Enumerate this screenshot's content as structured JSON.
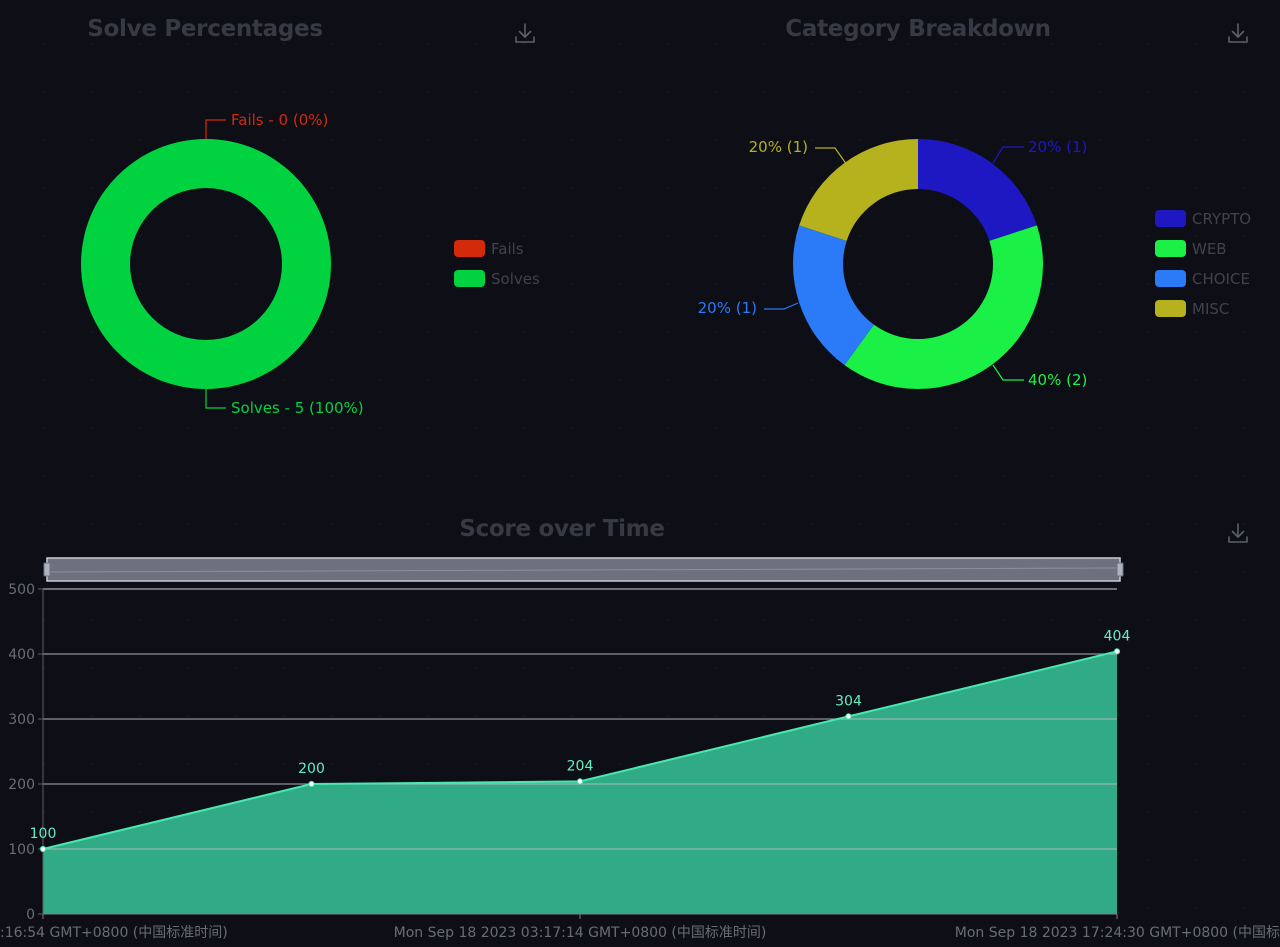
{
  "titles": {
    "solve": "Solve Percentages",
    "category": "Category Breakdown",
    "score": "Score over Time"
  },
  "icons": {
    "download": "download-icon"
  },
  "colors": {
    "background": "#0e0e17",
    "fails": "#d22a0a",
    "solves": "#00d240",
    "crypto": "#1e18c3",
    "web": "#1af045",
    "choice": "#2b7af7",
    "misc": "#b5b21d",
    "area_fill": "#31ab86",
    "area_line": "#49e8ad",
    "data_label": "#61f0c0",
    "axis_text": "#686c77",
    "legend_text": "#40434c",
    "title_text": "#373a44"
  },
  "chart_data": [
    {
      "type": "pie",
      "id": "solve",
      "title": "Solve Percentages",
      "slices": [
        {
          "name": "Fails",
          "value": 0,
          "label": "Fails - 0 (0%)",
          "color": "#d22a0a"
        },
        {
          "name": "Solves",
          "value": 5,
          "label": "Solves - 5 (100%)",
          "color": "#00d240"
        }
      ],
      "legend": [
        "Fails",
        "Solves"
      ],
      "legend_position": "right"
    },
    {
      "type": "pie",
      "id": "category",
      "title": "Category Breakdown",
      "slices": [
        {
          "name": "CRYPTO",
          "value": 1,
          "label": "20% (1)",
          "color": "#1e18c3"
        },
        {
          "name": "WEB",
          "value": 2,
          "label": "40% (2)",
          "color": "#1af045"
        },
        {
          "name": "CHOICE",
          "value": 1,
          "label": "20% (1)",
          "color": "#2b7af7"
        },
        {
          "name": "MISC",
          "value": 1,
          "label": "20% (1)",
          "color": "#b5b21d"
        }
      ],
      "legend": [
        "CRYPTO",
        "WEB",
        "CHOICE",
        "MISC"
      ],
      "legend_position": "right"
    },
    {
      "type": "area",
      "id": "score",
      "title": "Score over Time",
      "values": [
        100,
        200,
        204,
        304,
        404
      ],
      "ylim": [
        0,
        500
      ],
      "y_ticks": [
        0,
        100,
        200,
        300,
        400,
        500
      ],
      "x_tick_labels": [
        ":16:54 GMT+0800 (中国标准时间)",
        "Mon Sep 18 2023 03:17:14 GMT+0800 (中国标准时间)",
        "Mon Sep 18 2023 17:24:30 GMT+0800 (中国标"
      ],
      "grid": true,
      "data_zoom": true
    }
  ]
}
